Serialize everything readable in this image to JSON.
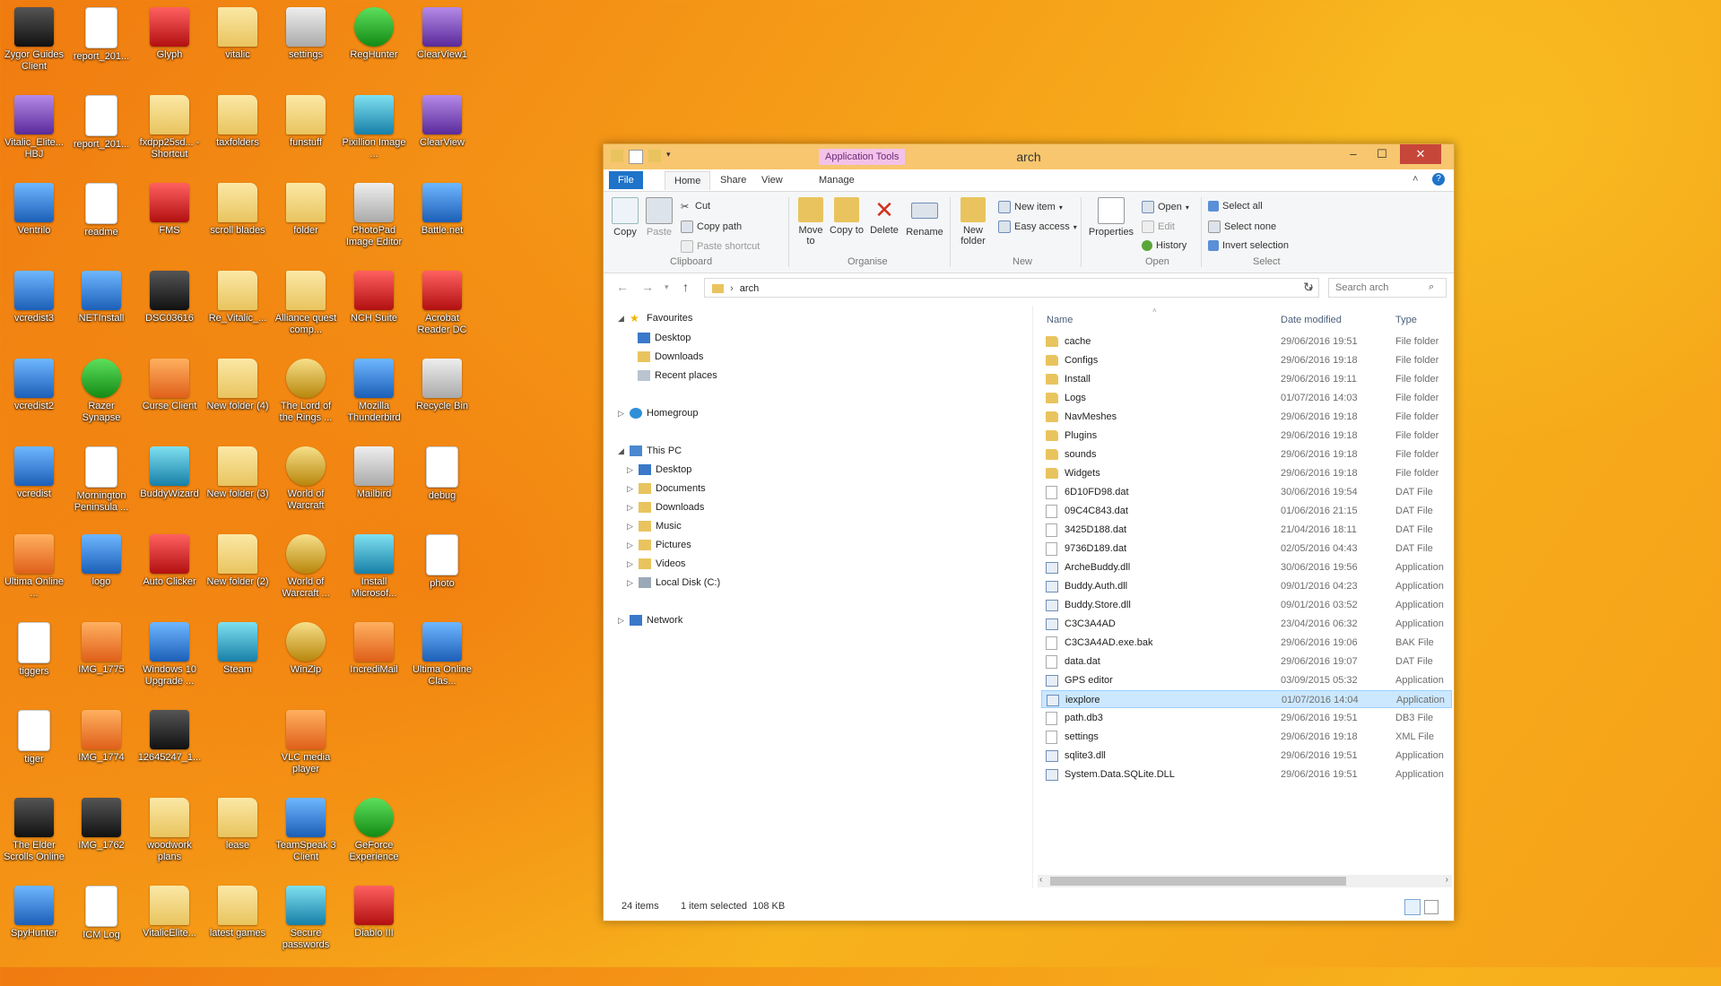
{
  "desktop": {
    "icons": [
      {
        "label": "Zygor Guides Client",
        "style": "dark"
      },
      {
        "label": "report_201...",
        "style": "doc"
      },
      {
        "label": "Glyph",
        "style": "red"
      },
      {
        "label": "vitalic",
        "style": "folder"
      },
      {
        "label": "settings",
        "style": "gray"
      },
      {
        "label": "RegHunter",
        "style": "green"
      },
      {
        "label": "ClearView1",
        "style": "purple"
      },
      {
        "label": "Vitalic_Elite... HBJ",
        "style": "purple"
      },
      {
        "label": "report_201...",
        "style": "doc"
      },
      {
        "label": "fxdpp25sd... - Shortcut",
        "style": "folder"
      },
      {
        "label": "taxfolders",
        "style": "folder"
      },
      {
        "label": "funstuff",
        "style": "folder"
      },
      {
        "label": "Pixillion Image ...",
        "style": "teal"
      },
      {
        "label": "ClearView",
        "style": "purple"
      },
      {
        "label": "Ventrilo",
        "style": "blue"
      },
      {
        "label": "readme",
        "style": "doc"
      },
      {
        "label": "FMS",
        "style": "red"
      },
      {
        "label": "scroll blades",
        "style": "folder"
      },
      {
        "label": "folder",
        "style": "folder"
      },
      {
        "label": "PhotoPad Image Editor",
        "style": "gray"
      },
      {
        "label": "Battle.net",
        "style": "blue"
      },
      {
        "label": "vcredist3",
        "style": "blue"
      },
      {
        "label": "NETInstall",
        "style": "blue"
      },
      {
        "label": "DSC03616",
        "style": "dark"
      },
      {
        "label": "Re_Vitalic_...",
        "style": "folder"
      },
      {
        "label": "Alliance quest comp...",
        "style": "folder"
      },
      {
        "label": "NCH Suite",
        "style": "red"
      },
      {
        "label": "Acrobat Reader DC",
        "style": "red"
      },
      {
        "label": "vcredist2",
        "style": "blue"
      },
      {
        "label": "Razer Synapse",
        "style": "green"
      },
      {
        "label": "Curse Client",
        "style": "orange"
      },
      {
        "label": "New folder (4)",
        "style": "folder"
      },
      {
        "label": "The Lord of the Rings ...",
        "style": "gold"
      },
      {
        "label": "Mozilla Thunderbird",
        "style": "blue"
      },
      {
        "label": "Recycle Bin",
        "style": "gray"
      },
      {
        "label": "vcredist",
        "style": "blue"
      },
      {
        "label": "Mornington Peninsula ...",
        "style": "doc"
      },
      {
        "label": "BuddyWizard",
        "style": "teal"
      },
      {
        "label": "New folder (3)",
        "style": "folder"
      },
      {
        "label": "World of Warcraft",
        "style": "gold"
      },
      {
        "label": "Mailbird",
        "style": "gray"
      },
      {
        "label": "debug",
        "style": "doc"
      },
      {
        "label": "Ultima Online ...",
        "style": "orange"
      },
      {
        "label": "logo",
        "style": "blue"
      },
      {
        "label": "Auto Clicker",
        "style": "red"
      },
      {
        "label": "New folder (2)",
        "style": "folder"
      },
      {
        "label": "World of Warcraft ...",
        "style": "gold"
      },
      {
        "label": "Install Microsof...",
        "style": "teal"
      },
      {
        "label": "photo",
        "style": "doc"
      },
      {
        "label": "tiggers",
        "style": "doc"
      },
      {
        "label": "IMG_1775",
        "style": "orange"
      },
      {
        "label": "Windows 10 Upgrade ...",
        "style": "blue"
      },
      {
        "label": "Steam",
        "style": "teal"
      },
      {
        "label": "WinZip",
        "style": "gold"
      },
      {
        "label": "IncrediMail",
        "style": "orange"
      },
      {
        "label": "Ultima Online Clas...",
        "style": "blue"
      },
      {
        "label": "tiger",
        "style": "doc"
      },
      {
        "label": "IMG_1774",
        "style": "orange"
      },
      {
        "label": "12645247_1...",
        "style": "dark"
      },
      {
        "label": "",
        "style": "empty"
      },
      {
        "label": "VLC media player",
        "style": "orange"
      },
      {
        "label": "",
        "style": "empty"
      },
      {
        "label": "",
        "style": "empty"
      },
      {
        "label": "The Elder Scrolls Online",
        "style": "dark"
      },
      {
        "label": "IMG_1762",
        "style": "dark"
      },
      {
        "label": "woodwork plans",
        "style": "folder"
      },
      {
        "label": "lease",
        "style": "folder"
      },
      {
        "label": "TeamSpeak 3 Client",
        "style": "blue"
      },
      {
        "label": "GeForce Experience",
        "style": "green"
      },
      {
        "label": "",
        "style": "empty"
      },
      {
        "label": "SpyHunter",
        "style": "blue"
      },
      {
        "label": "ICM Log",
        "style": "doc"
      },
      {
        "label": "VitalicElite...",
        "style": "folder"
      },
      {
        "label": "latest games",
        "style": "folder"
      },
      {
        "label": "Secure passwords",
        "style": "teal"
      },
      {
        "label": "Diablo III",
        "style": "red"
      }
    ]
  },
  "window": {
    "title": "arch",
    "context_tab": "Application Tools",
    "tabs": [
      "File",
      "Home",
      "Share",
      "View",
      "Manage"
    ],
    "ribbon": {
      "clipboard": {
        "copy": "Copy",
        "paste": "Paste",
        "cut": "Cut",
        "copy_path": "Copy path",
        "paste_shortcut": "Paste shortcut",
        "label": "Clipboard"
      },
      "organise": {
        "move_to": "Move to",
        "copy_to": "Copy to",
        "delete": "Delete",
        "rename": "Rename",
        "label": "Organise"
      },
      "new": {
        "new_folder": "New folder",
        "new_item": "New item",
        "easy_access": "Easy access",
        "label": "New"
      },
      "open": {
        "properties": "Properties",
        "open": "Open",
        "edit": "Edit",
        "history": "History",
        "label": "Open"
      },
      "select": {
        "select_all": "Select all",
        "select_none": "Select none",
        "invert": "Invert selection",
        "label": "Select"
      }
    },
    "address": "arch",
    "search_placeholder": "Search arch",
    "nav": {
      "favourites": "Favourites",
      "fav_items": [
        "Desktop",
        "Downloads",
        "Recent places"
      ],
      "homegroup": "Homegroup",
      "this_pc": "This PC",
      "pc_items": [
        "Desktop",
        "Documents",
        "Downloads",
        "Music",
        "Pictures",
        "Videos",
        "Local Disk (C:)"
      ],
      "network": "Network"
    },
    "columns": {
      "name": "Name",
      "date": "Date modified",
      "type": "Type"
    },
    "files": [
      {
        "name": "cache",
        "date": "29/06/2016 19:51",
        "type": "File folder",
        "icon": "folder"
      },
      {
        "name": "Configs",
        "date": "29/06/2016 19:18",
        "type": "File folder",
        "icon": "folder"
      },
      {
        "name": "Install",
        "date": "29/06/2016 19:11",
        "type": "File folder",
        "icon": "folder"
      },
      {
        "name": "Logs",
        "date": "01/07/2016 14:03",
        "type": "File folder",
        "icon": "folder"
      },
      {
        "name": "NavMeshes",
        "date": "29/06/2016 19:18",
        "type": "File folder",
        "icon": "folder"
      },
      {
        "name": "Plugins",
        "date": "29/06/2016 19:18",
        "type": "File folder",
        "icon": "folder"
      },
      {
        "name": "sounds",
        "date": "29/06/2016 19:18",
        "type": "File folder",
        "icon": "folder"
      },
      {
        "name": "Widgets",
        "date": "29/06/2016 19:18",
        "type": "File folder",
        "icon": "folder"
      },
      {
        "name": "6D10FD98.dat",
        "date": "30/06/2016 19:54",
        "type": "DAT File",
        "icon": "file"
      },
      {
        "name": "09C4C843.dat",
        "date": "01/06/2016 21:15",
        "type": "DAT File",
        "icon": "file"
      },
      {
        "name": "3425D188.dat",
        "date": "21/04/2016 18:11",
        "type": "DAT File",
        "icon": "file"
      },
      {
        "name": "9736D189.dat",
        "date": "02/05/2016 04:43",
        "type": "DAT File",
        "icon": "file"
      },
      {
        "name": "ArcheBuddy.dll",
        "date": "30/06/2016 19:56",
        "type": "Application",
        "icon": "app"
      },
      {
        "name": "Buddy.Auth.dll",
        "date": "09/01/2016 04:23",
        "type": "Application",
        "icon": "app"
      },
      {
        "name": "Buddy.Store.dll",
        "date": "09/01/2016 03:52",
        "type": "Application",
        "icon": "app"
      },
      {
        "name": "C3C3A4AD",
        "date": "23/04/2016 06:32",
        "type": "Application",
        "icon": "app"
      },
      {
        "name": "C3C3A4AD.exe.bak",
        "date": "29/06/2016 19:06",
        "type": "BAK File",
        "icon": "file"
      },
      {
        "name": "data.dat",
        "date": "29/06/2016 19:07",
        "type": "DAT File",
        "icon": "file"
      },
      {
        "name": "GPS editor",
        "date": "03/09/2015 05:32",
        "type": "Application",
        "icon": "app"
      },
      {
        "name": "iexplore",
        "date": "01/07/2016 14:04",
        "type": "Application",
        "icon": "app",
        "selected": true
      },
      {
        "name": "path.db3",
        "date": "29/06/2016 19:51",
        "type": "DB3 File",
        "icon": "file"
      },
      {
        "name": "settings",
        "date": "29/06/2016 19:18",
        "type": "XML File",
        "icon": "file"
      },
      {
        "name": "sqlite3.dll",
        "date": "29/06/2016 19:51",
        "type": "Application",
        "icon": "app"
      },
      {
        "name": "System.Data.SQLite.DLL",
        "date": "29/06/2016 19:51",
        "type": "Application",
        "icon": "app"
      }
    ],
    "status": {
      "items": "24 items",
      "selected": "1 item selected  108 KB"
    }
  }
}
